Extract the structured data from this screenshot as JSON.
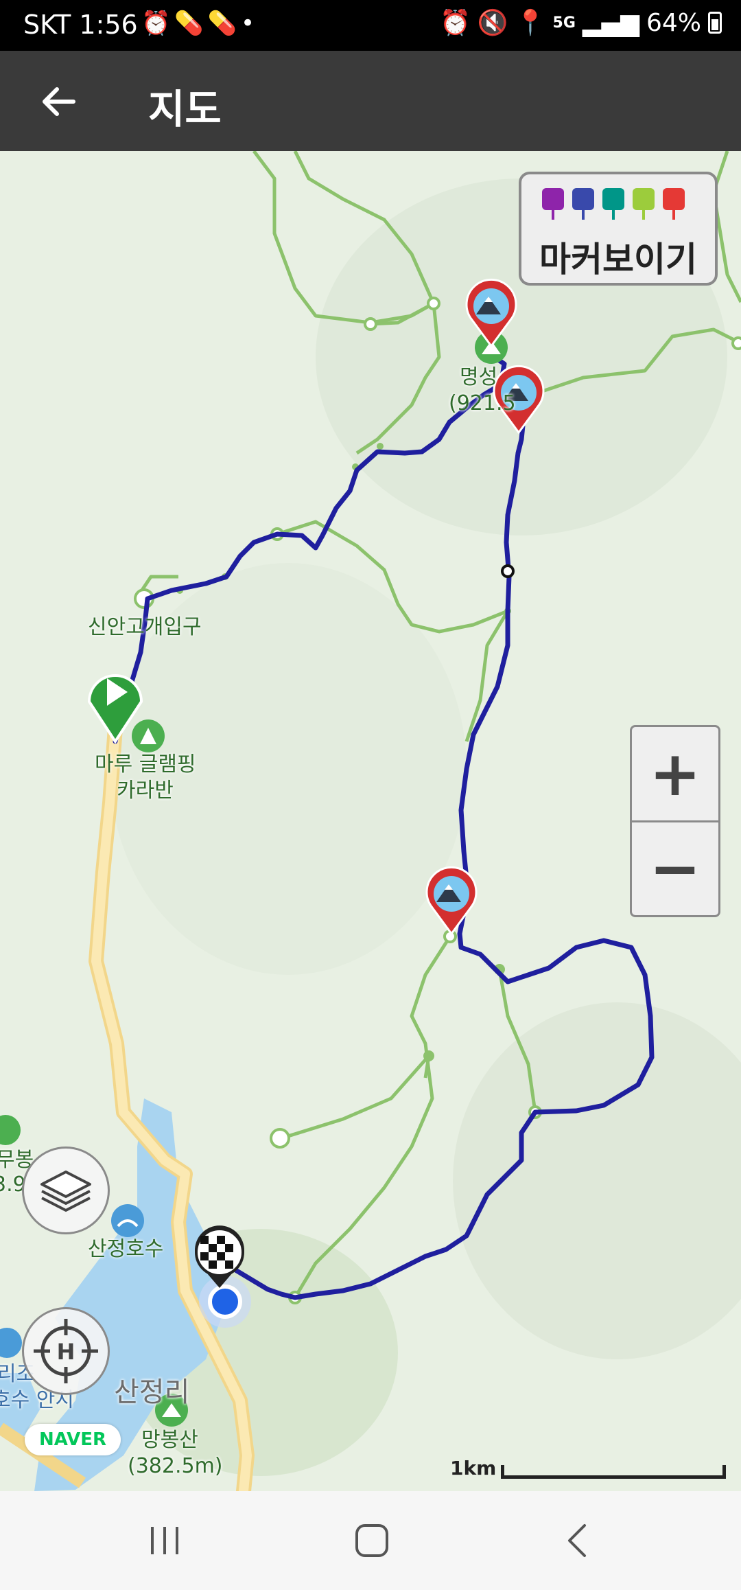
{
  "status_bar": {
    "carrier_time": "SKT 1:56",
    "left_icons": [
      "alarm-icon",
      "pill-icon",
      "pill-icon",
      "dot"
    ],
    "right_icons": [
      "alarm-icon",
      "mute-icon",
      "location-icon",
      "5g-icon",
      "signal-icon"
    ],
    "battery": "64%"
  },
  "app_bar": {
    "back_icon": "arrow-left-icon",
    "title": "지도"
  },
  "map": {
    "labels": {
      "myeongseong": "명성",
      "myeongseong_elev": "(921.5",
      "sinan": "신안고개입구",
      "glamping_1": "마루 글램핑",
      "glamping_2": "카라반",
      "sanjeong_lake": "산정호수",
      "sanjeongri": "산정리",
      "mangbong": "망봉산",
      "mangbong_elev": "(382.5m)",
      "left_peak_1": "무봉",
      "left_peak_2": "3.9",
      "left_resort_1": "리조",
      "left_resort_2": "호수 안시"
    },
    "track_color": "#1f1f9e",
    "trail_color": "#8cc26c",
    "road_color": "#f6dc95",
    "water_color": "#a9d4f0"
  },
  "marker_panel": {
    "label": "마커보이기",
    "pins": [
      {
        "icon": "camera-icon",
        "color": "#8e24aa"
      },
      {
        "icon": "video-icon",
        "color": "#3949ab"
      },
      {
        "icon": "pen-icon",
        "color": "#009688"
      },
      {
        "icon": "memo-icon",
        "color": "#9ccc3c"
      },
      {
        "icon": "flag-icon",
        "color": "#e53935"
      }
    ]
  },
  "zoom": {
    "in": "+",
    "out": "−"
  },
  "naver_logo": "NAVER",
  "scale": {
    "label": "1km"
  }
}
